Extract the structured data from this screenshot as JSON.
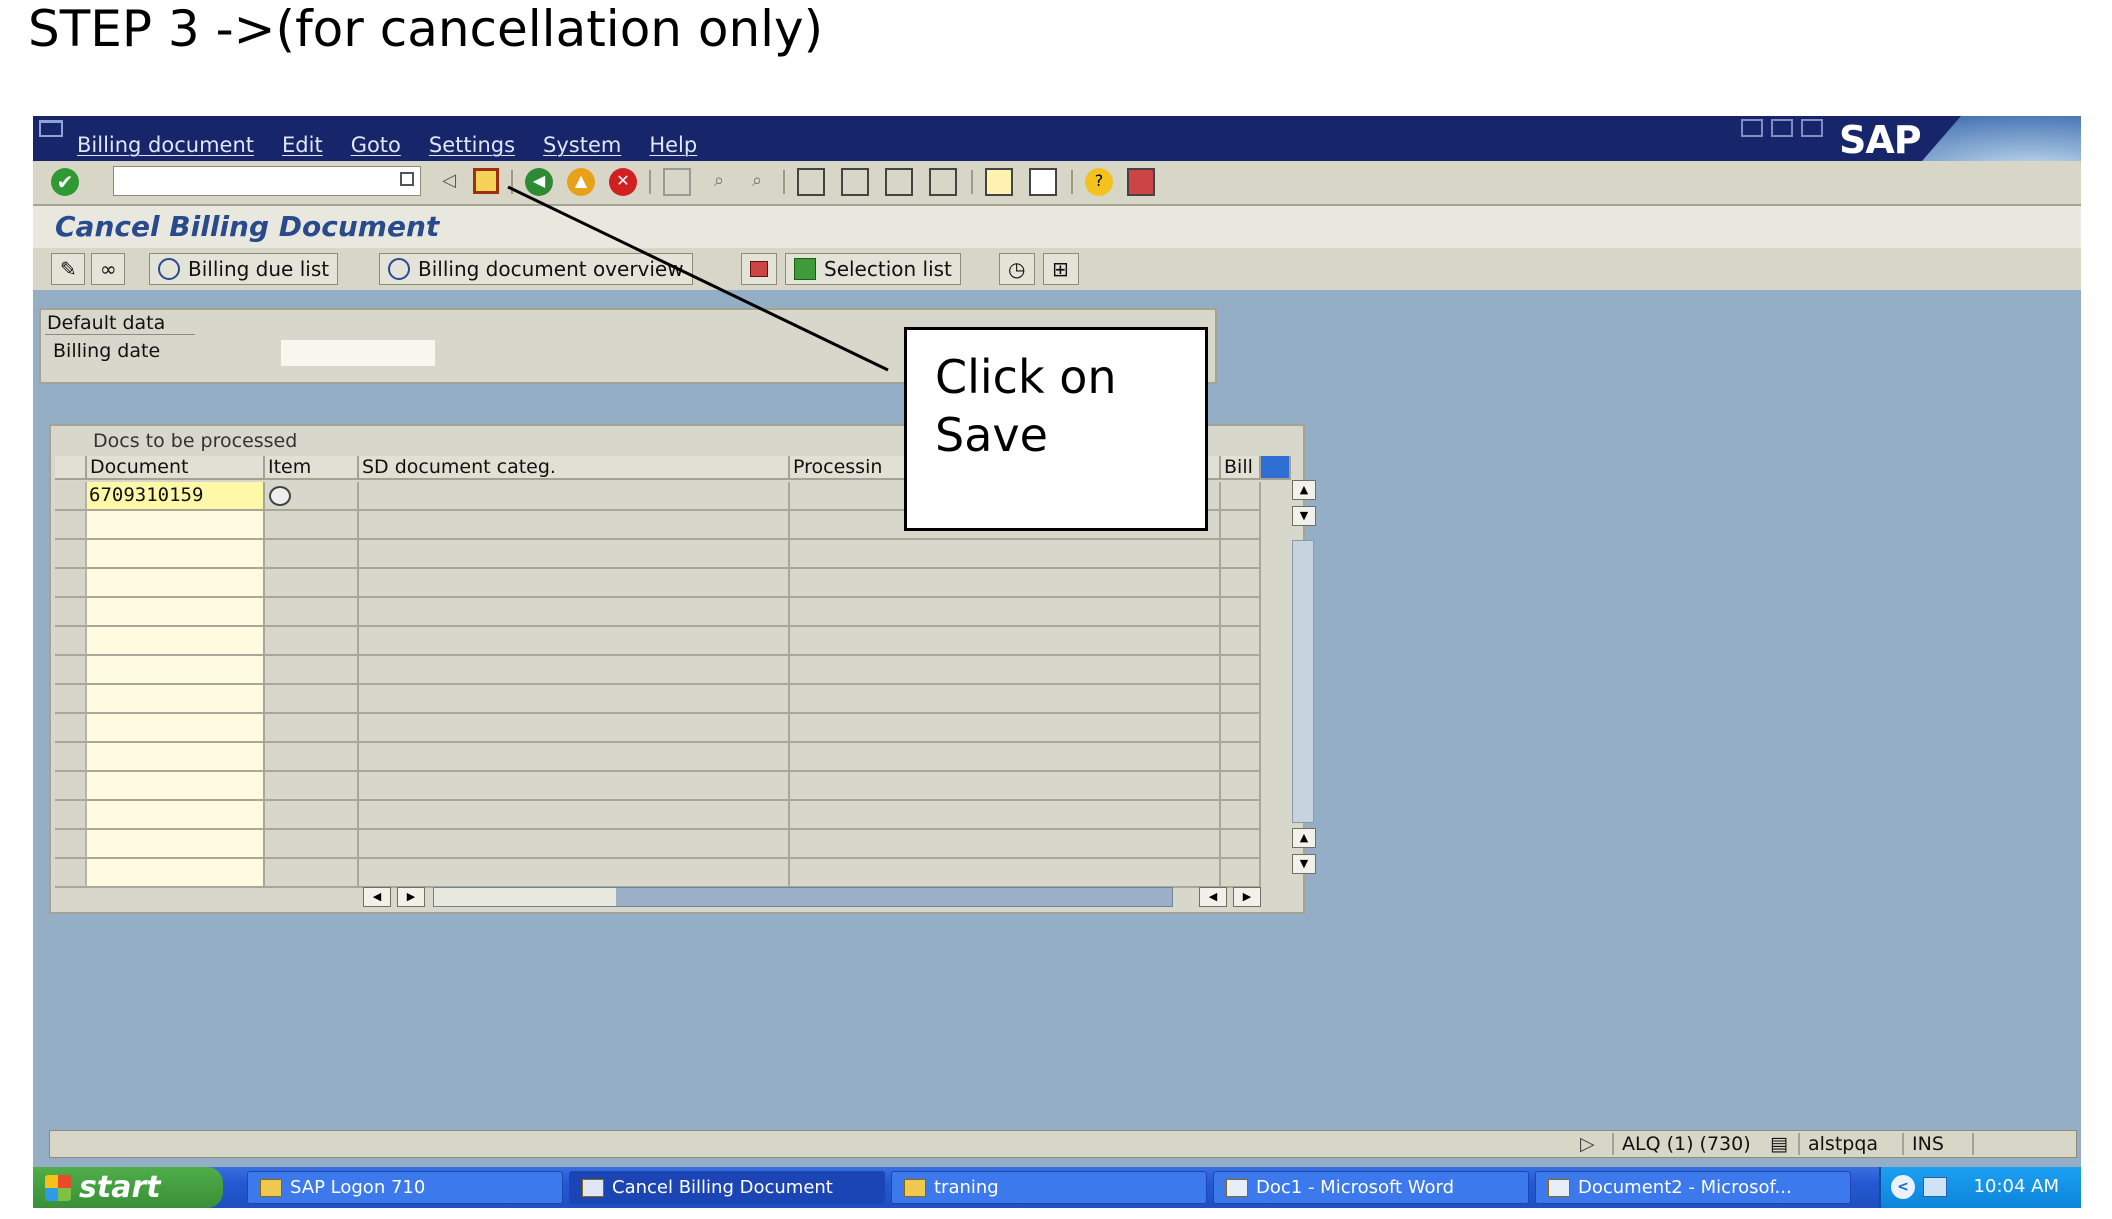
{
  "step_title": "STEP 3 ->(for cancellation only)",
  "menu": [
    "Billing document",
    "Edit",
    "Goto",
    "Settings",
    "System",
    "Help"
  ],
  "logo_text": "SAP",
  "page_title": "Cancel Billing Document",
  "app_toolbar": {
    "billing_due_list": "Billing due list",
    "billing_document_overview": "Billing document overview",
    "selection_list": "Selection list"
  },
  "default_data": {
    "tab": "Default data",
    "billing_date_label": "Billing date",
    "billing_date_value": ""
  },
  "docs_table": {
    "caption": "Docs to be processed",
    "columns": [
      "Document",
      "Item",
      "SD document categ.",
      "Processin",
      "Bill"
    ],
    "rows": [
      {
        "document": "6709310159",
        "item": "",
        "sd_document_categ": "",
        "processing": "",
        "bill": ""
      }
    ]
  },
  "callout": {
    "line1": "Click on",
    "line2": "Save"
  },
  "status_bar": {
    "system": "ALQ (1) (730)",
    "server": "alstpqa",
    "mode": "INS"
  },
  "taskbar": {
    "start": "start",
    "tasks": [
      "SAP Logon 710",
      "Cancel Billing Document",
      "traning",
      "Doc1 - Microsoft Word",
      "Document2 - Microsof..."
    ],
    "clock": "10:04 AM"
  }
}
